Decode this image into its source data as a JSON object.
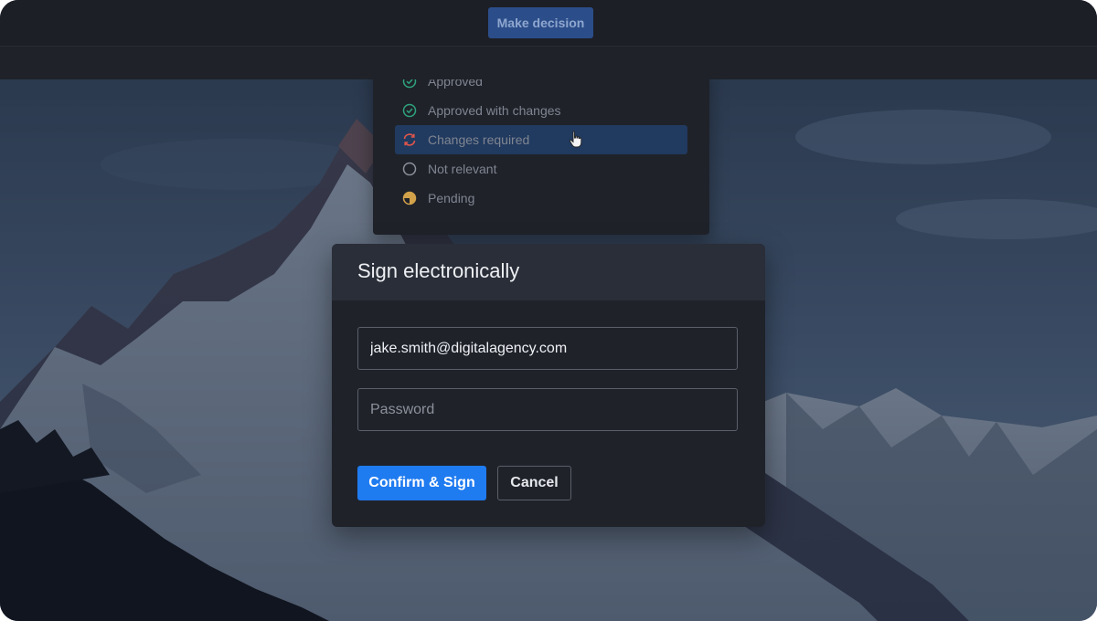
{
  "toolbar": {
    "make_decision_label": "Make decision"
  },
  "decision_menu": {
    "items": [
      {
        "label": "Approved",
        "icon": "check-circle-icon",
        "color": "#2fa37d"
      },
      {
        "label": "Approved with changes",
        "icon": "check-circle-icon",
        "color": "#2fa37d"
      },
      {
        "label": "Changes required",
        "icon": "refresh-icon",
        "color": "#e0564b",
        "state": "hovered"
      },
      {
        "label": "Not relevant",
        "icon": "empty-circle-icon",
        "color": "#8c919b"
      },
      {
        "label": "Pending",
        "icon": "half-circle-icon",
        "color": "#d2a24a"
      }
    ]
  },
  "sign_dialog": {
    "title": "Sign electronically",
    "email_value": "jake.smith@digitalagency.com",
    "password_placeholder": "Password",
    "confirm_label": "Confirm & Sign",
    "cancel_label": "Cancel"
  },
  "colors": {
    "primary": "#1f7bf0",
    "surface": "#1f2229",
    "header_surface": "#2a2e38",
    "hover_row": "#213a5f"
  }
}
